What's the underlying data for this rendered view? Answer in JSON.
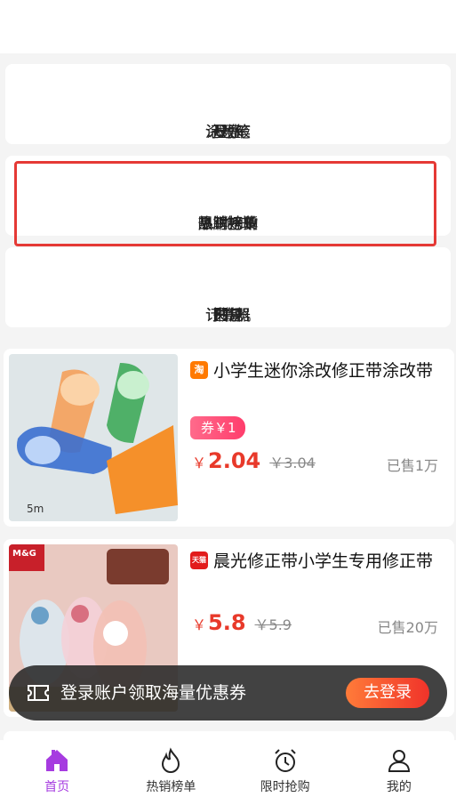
{
  "categories_row1": [
    {
      "label": "记号笔",
      "icon": "marker-icon"
    },
    {
      "label": "尺子",
      "icon": "ruler-icon"
    },
    {
      "label": "U盘",
      "icon": "usb-drive-icon"
    },
    {
      "label": "墨水",
      "icon": "ink-icon"
    },
    {
      "label": "涂改液",
      "icon": "correction-fluid-icon"
    }
  ],
  "categories_row2": [
    {
      "label": "热销榜单",
      "icon": "hot-list-icon"
    },
    {
      "label": "9.9包邮",
      "icon": "free-shipping-icon"
    },
    {
      "label": "限时抢购",
      "icon": "flash-sale-icon"
    },
    {
      "label": "品牌好货",
      "icon": "brand-goods-icon"
    }
  ],
  "categories_row3": [
    {
      "label": "订书机",
      "icon": "stapler-icon"
    },
    {
      "label": "计算器",
      "icon": "calculator-icon"
    },
    {
      "label": "圆规",
      "icon": "compass-icon"
    },
    {
      "label": "夹子",
      "icon": "clip-icon"
    },
    {
      "label": "书包",
      "icon": "schoolbag-icon"
    }
  ],
  "products": [
    {
      "shop_badge": "淘",
      "title": "小学生迷你涂改修正带涂改带",
      "coupon": "券￥1",
      "currency": "￥",
      "price": "2.04",
      "original_price": "￥3.04",
      "sold": "已售1万"
    },
    {
      "shop_badge": "天猫",
      "title": "晨光修正带小学生专用修正带",
      "currency": "￥",
      "price": "5.8",
      "original_price": "￥5.9",
      "sold": "已售20万"
    }
  ],
  "login_banner": {
    "text": "登录账户领取海量优惠券",
    "button": "去登录"
  },
  "tabbar": [
    {
      "label": "首页",
      "icon": "home-icon",
      "active": true
    },
    {
      "label": "热销榜单",
      "icon": "flame-icon",
      "active": false
    },
    {
      "label": "限时抢购",
      "icon": "alarm-clock-icon",
      "active": false
    },
    {
      "label": "我的",
      "icon": "user-icon",
      "active": false
    }
  ],
  "colors": {
    "accent": "#a63be0",
    "price": "#e8392a",
    "highlight_border": "#e53935"
  }
}
